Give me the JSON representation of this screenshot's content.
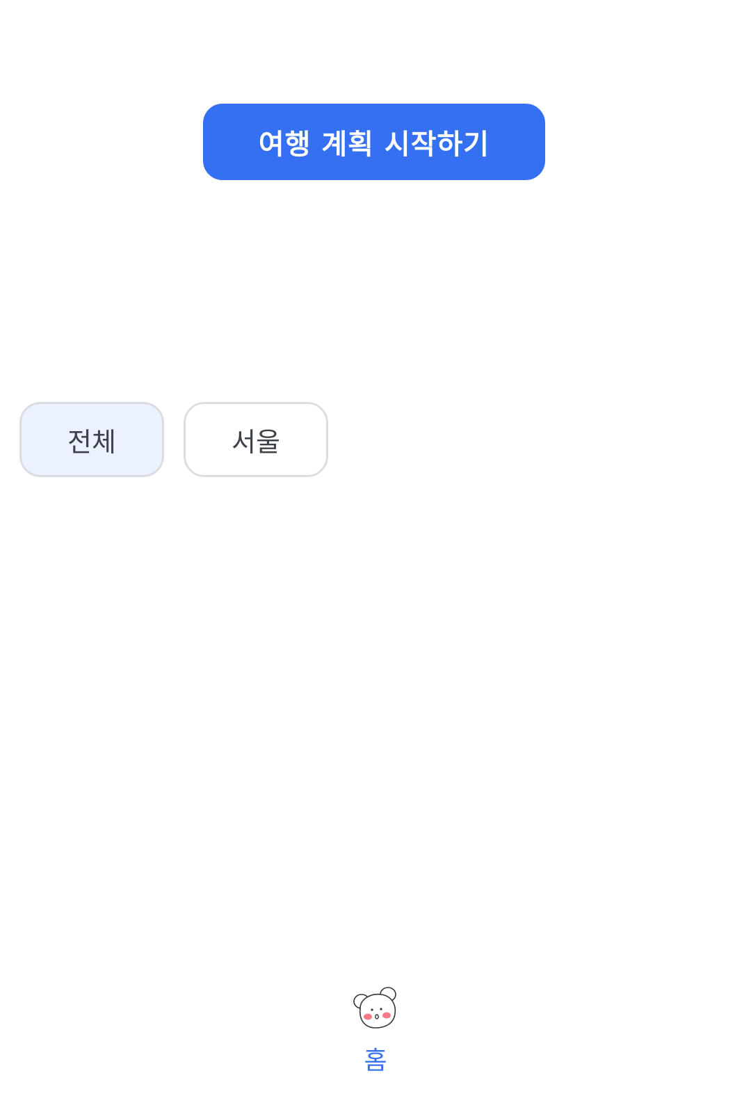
{
  "main": {
    "start_button_label": "여행 계획 시작하기"
  },
  "filters": {
    "chips": [
      {
        "label": "전체",
        "selected": true
      },
      {
        "label": "서울",
        "selected": false
      }
    ]
  },
  "bottom_nav": {
    "items": [
      {
        "label": "홈",
        "icon": "bear-face-icon",
        "active": true
      }
    ]
  },
  "colors": {
    "accent": "#3570f3",
    "chip_selected_bg": "#ebf1fe",
    "chip_border": "#dcdde1",
    "chip_text": "#3e4149"
  }
}
